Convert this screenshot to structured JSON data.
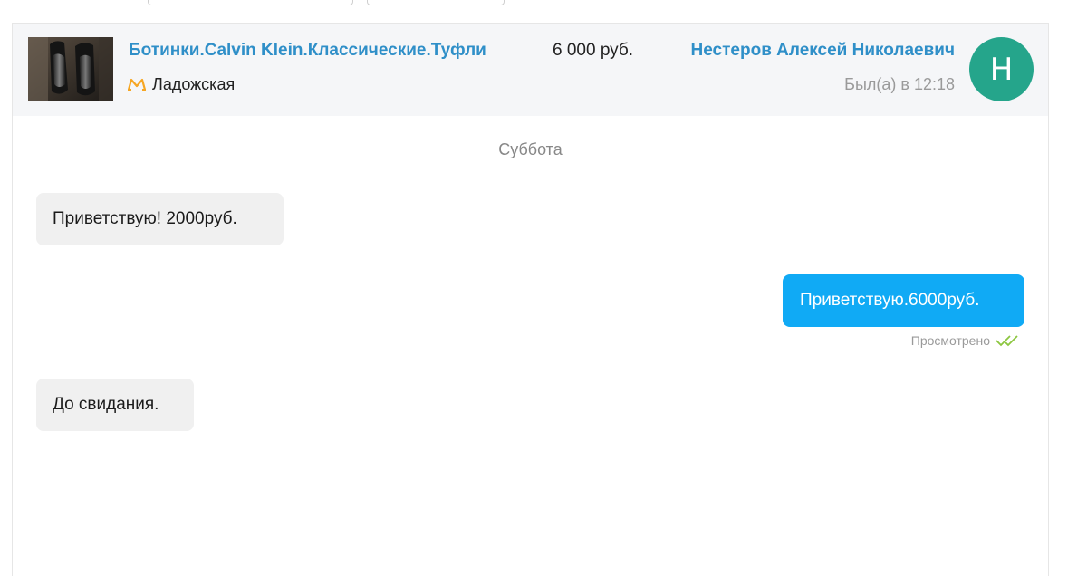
{
  "listing": {
    "title": "Ботинки.Calvin Klein.Классические.Туфли",
    "price": "6 000 руб.",
    "metro_station": "Ладожская",
    "thumbnail_icon": "shoes-photo-icon"
  },
  "user": {
    "name": "Нестеров Алексей Николаевич",
    "last_seen": "Был(а) в 12:18",
    "avatar_letter": "Н",
    "avatar_color": "#25a58b"
  },
  "chat": {
    "day_separator": "Суббота",
    "messages": [
      {
        "direction": "incoming",
        "text": "Приветствую! 2000руб."
      },
      {
        "direction": "outgoing",
        "text": "Приветствую.6000руб.",
        "status": "Просмотрено"
      },
      {
        "direction": "incoming",
        "text": "До свидания."
      }
    ]
  },
  "colors": {
    "link": "#2f8fc8",
    "outgoing_bubble": "#10aaf5",
    "incoming_bubble": "#f0f0f0",
    "read_check": "#8cc63f",
    "metro_icon": "#f6a623"
  }
}
